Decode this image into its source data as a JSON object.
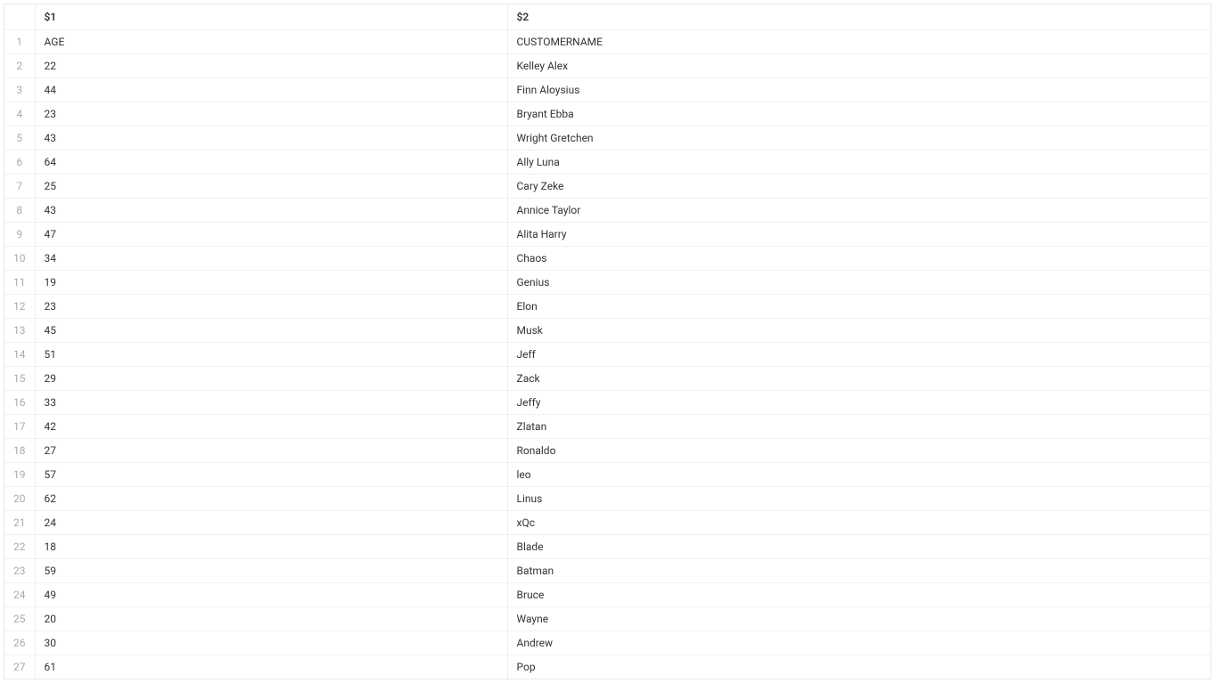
{
  "table": {
    "columns": [
      "$1",
      "$2"
    ],
    "rows": [
      {
        "n": "1",
        "c1": "AGE",
        "c2": "CUSTOMERNAME"
      },
      {
        "n": "2",
        "c1": "22",
        "c2": "Kelley Alex"
      },
      {
        "n": "3",
        "c1": "44",
        "c2": "Finn Aloysius"
      },
      {
        "n": "4",
        "c1": "23",
        "c2": "Bryant Ebba"
      },
      {
        "n": "5",
        "c1": "43",
        "c2": "Wright Gretchen"
      },
      {
        "n": "6",
        "c1": "64",
        "c2": "Ally Luna"
      },
      {
        "n": "7",
        "c1": "25",
        "c2": "Cary Zeke"
      },
      {
        "n": "8",
        "c1": "43",
        "c2": "Annice Taylor"
      },
      {
        "n": "9",
        "c1": "47",
        "c2": "Alita Harry"
      },
      {
        "n": "10",
        "c1": "34",
        "c2": "Chaos"
      },
      {
        "n": "11",
        "c1": "19",
        "c2": "Genius"
      },
      {
        "n": "12",
        "c1": "23",
        "c2": "Elon"
      },
      {
        "n": "13",
        "c1": "45",
        "c2": "Musk"
      },
      {
        "n": "14",
        "c1": "51",
        "c2": "Jeff"
      },
      {
        "n": "15",
        "c1": "29",
        "c2": "Zack"
      },
      {
        "n": "16",
        "c1": "33",
        "c2": "Jeffy"
      },
      {
        "n": "17",
        "c1": "42",
        "c2": "Zlatan"
      },
      {
        "n": "18",
        "c1": "27",
        "c2": "Ronaldo"
      },
      {
        "n": "19",
        "c1": "57",
        "c2": "leo"
      },
      {
        "n": "20",
        "c1": "62",
        "c2": "Linus"
      },
      {
        "n": "21",
        "c1": "24",
        "c2": "xQc"
      },
      {
        "n": "22",
        "c1": "18",
        "c2": "Blade"
      },
      {
        "n": "23",
        "c1": "59",
        "c2": "Batman"
      },
      {
        "n": "24",
        "c1": "49",
        "c2": "Bruce"
      },
      {
        "n": "25",
        "c1": "20",
        "c2": "Wayne"
      },
      {
        "n": "26",
        "c1": "30",
        "c2": "Andrew"
      },
      {
        "n": "27",
        "c1": "61",
        "c2": "Pop"
      }
    ]
  }
}
